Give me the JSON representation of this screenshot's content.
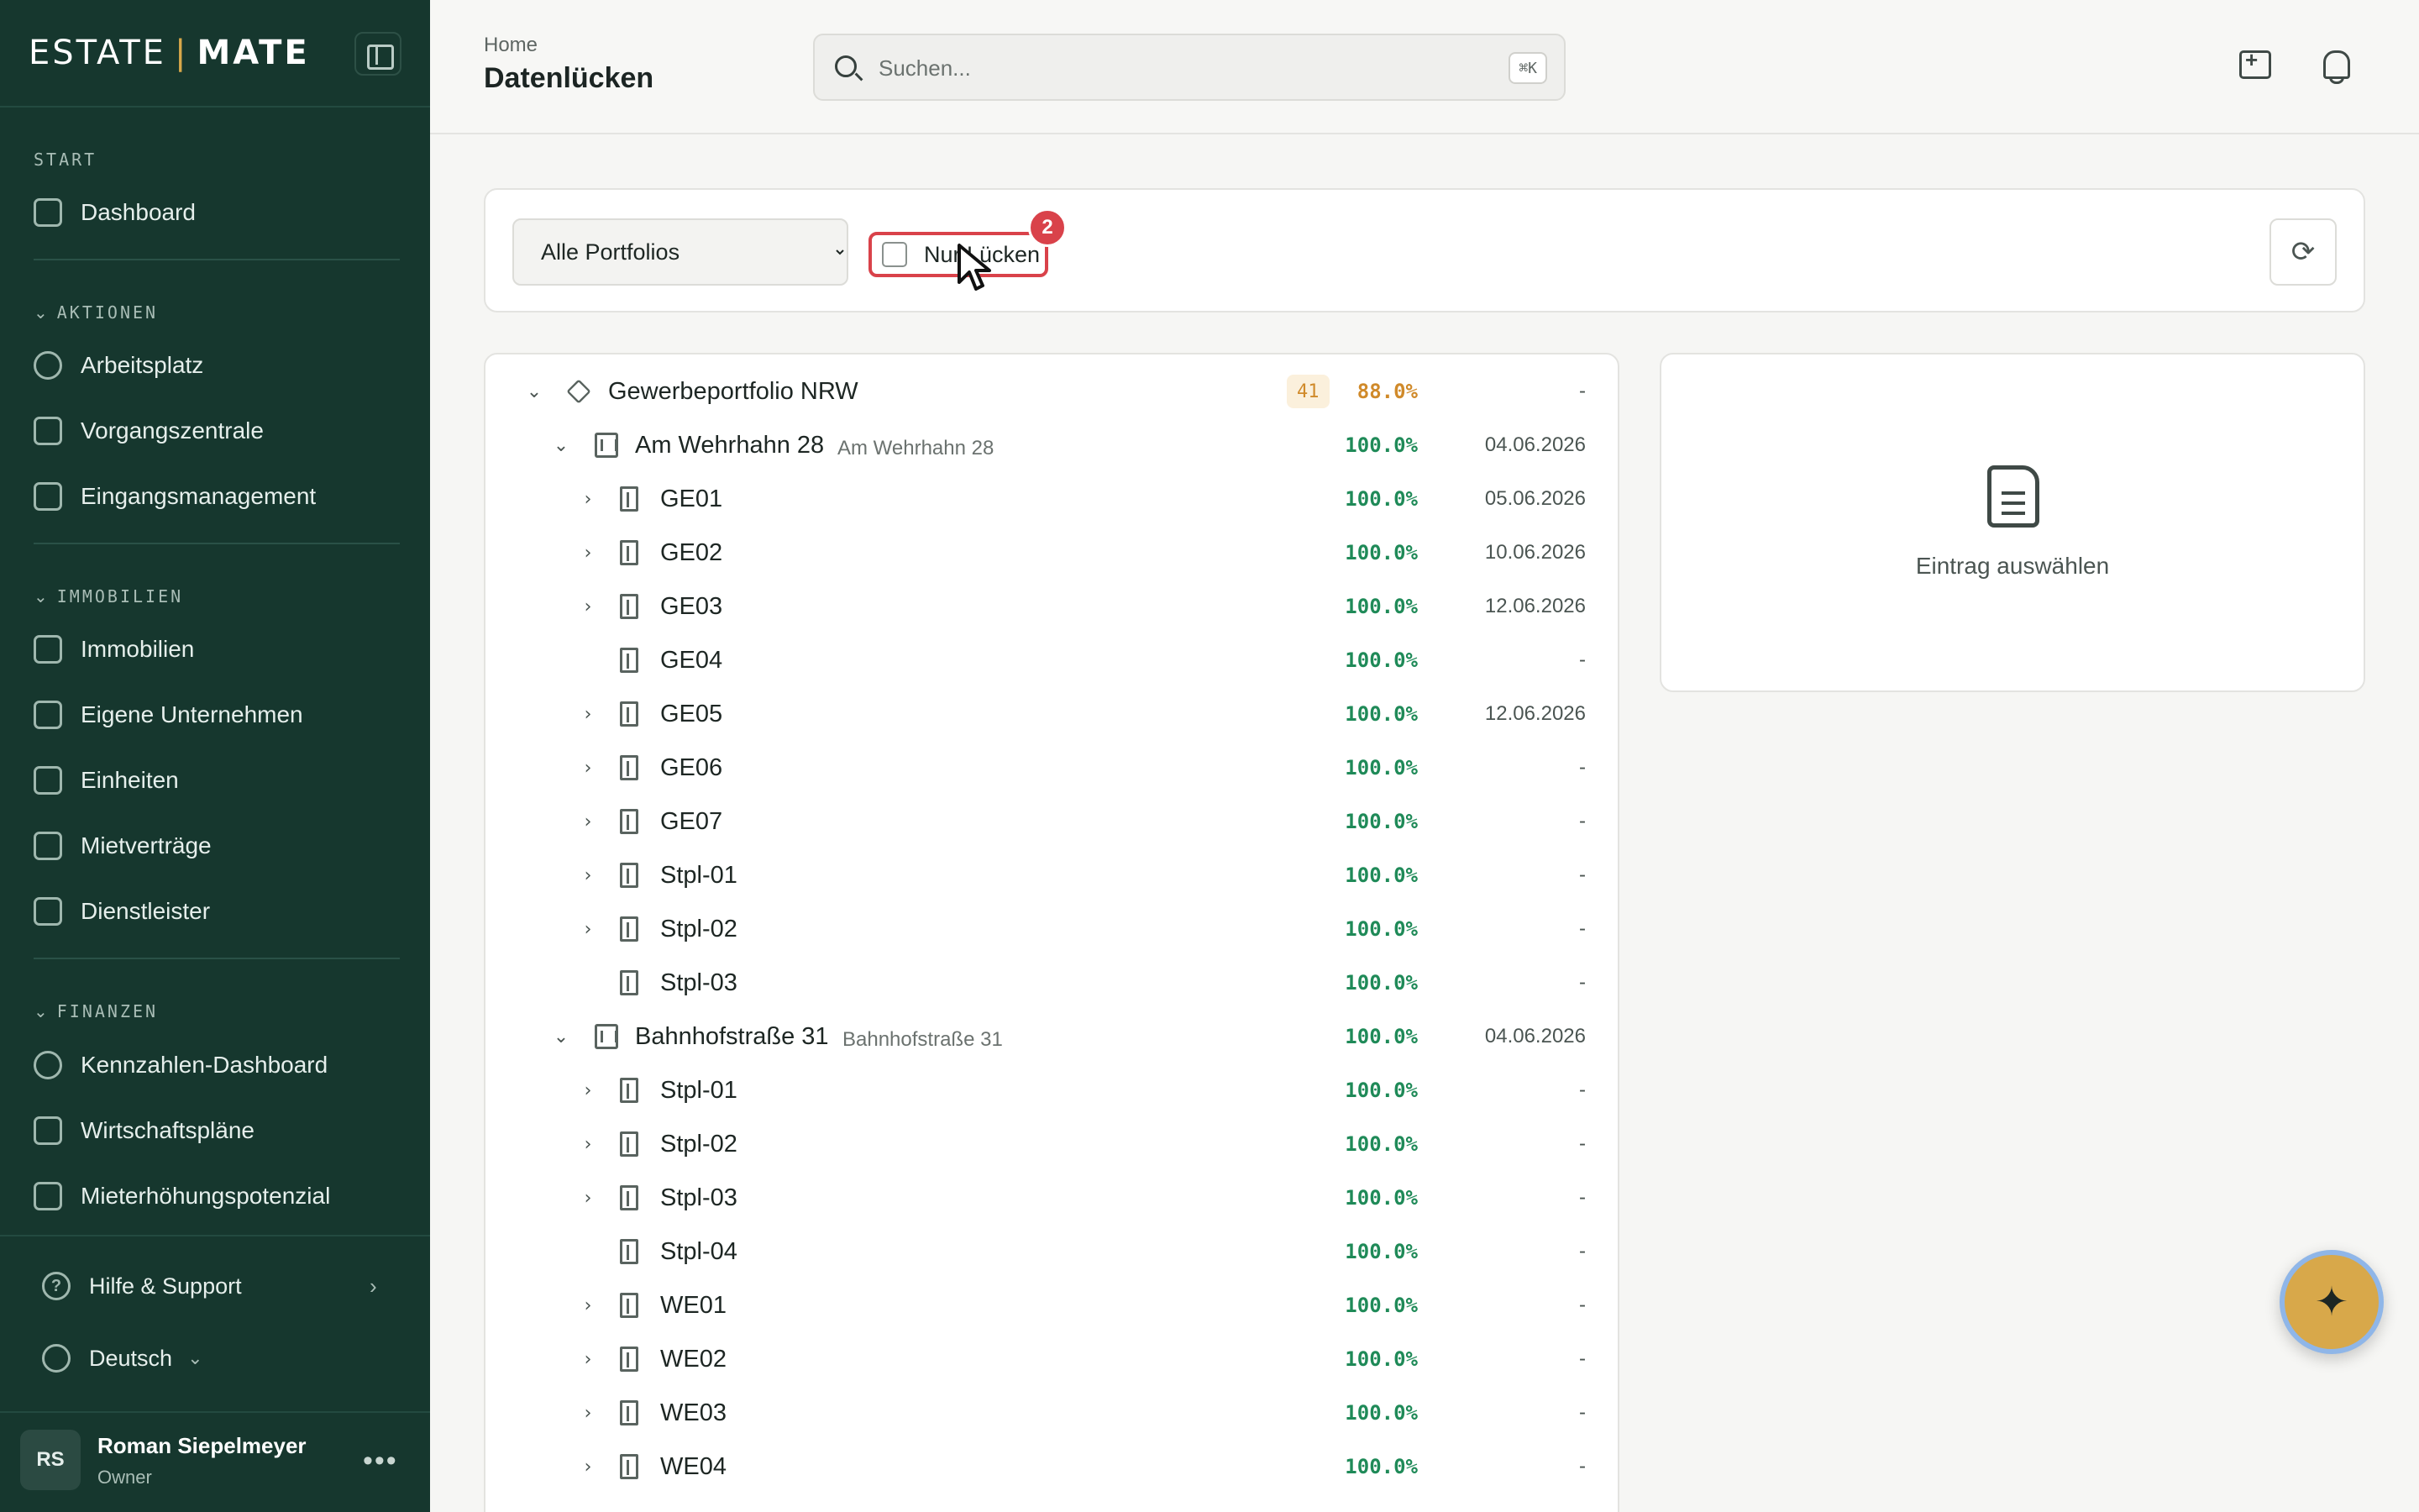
{
  "brand": {
    "part1": "ESTATE",
    "separator": "|",
    "part2": "MATE"
  },
  "sidebar": {
    "sections": [
      {
        "label": "START",
        "items": [
          {
            "label": "Dashboard",
            "icon": "dashboard-icon"
          }
        ]
      },
      {
        "label": "AKTIONEN",
        "items": [
          {
            "label": "Arbeitsplatz",
            "icon": "check-circle-icon"
          },
          {
            "label": "Vorgangszentrale",
            "icon": "workflow-icon"
          },
          {
            "label": "Eingangsmanagement",
            "icon": "inbox-icon"
          }
        ]
      },
      {
        "label": "IMMOBILIEN",
        "items": [
          {
            "label": "Immobilien",
            "icon": "building-icon"
          },
          {
            "label": "Eigene Unternehmen",
            "icon": "factory-icon"
          },
          {
            "label": "Einheiten",
            "icon": "home-icon"
          },
          {
            "label": "Mietverträge",
            "icon": "contract-icon"
          },
          {
            "label": "Dienstleister",
            "icon": "handshake-icon"
          }
        ]
      },
      {
        "label": "FINANZEN",
        "items": [
          {
            "label": "Kennzahlen-Dashboard",
            "icon": "gauge-icon"
          },
          {
            "label": "Wirtschaftspläne",
            "icon": "calculator-icon"
          },
          {
            "label": "Mieterhöhungspotenzial",
            "icon": "bar-chart-icon"
          }
        ]
      }
    ],
    "help": "Hilfe & Support",
    "language": "Deutsch",
    "user": {
      "initials": "RS",
      "name": "Roman Siepelmeyer",
      "role": "Owner"
    }
  },
  "header": {
    "breadcrumb": "Home",
    "title": "Datenlücken",
    "search_placeholder": "Suchen...",
    "search_shortcut": "⌘K"
  },
  "toolbar": {
    "portfolio_options": [
      "Alle Portfolios"
    ],
    "portfolio_selected": "Alle Portfolios",
    "gap_filter_label": "Nur Lücken",
    "gap_filter_checked": false,
    "step_badge": "2"
  },
  "tree": [
    {
      "level": 0,
      "name": "Gewerbeportfolio NRW",
      "count": "41",
      "pct": "88.0%",
      "date": "-",
      "expanded": true,
      "icon": "layers-icon"
    },
    {
      "level": 1,
      "name": "Am Wehrhahn 28",
      "sub": "Am Wehrhahn 28",
      "pct": "100.0%",
      "date": "04.06.2026",
      "expanded": true,
      "icon": "building-icon"
    },
    {
      "level": 2,
      "name": "GE01",
      "pct": "100.0%",
      "date": "05.06.2026",
      "has_children": true,
      "icon": "door-icon"
    },
    {
      "level": 2,
      "name": "GE02",
      "pct": "100.0%",
      "date": "10.06.2026",
      "has_children": true,
      "icon": "door-icon"
    },
    {
      "level": 2,
      "name": "GE03",
      "pct": "100.0%",
      "date": "12.06.2026",
      "has_children": true,
      "icon": "door-icon"
    },
    {
      "level": 2,
      "name": "GE04",
      "pct": "100.0%",
      "date": "-",
      "has_children": false,
      "icon": "door-icon"
    },
    {
      "level": 2,
      "name": "GE05",
      "pct": "100.0%",
      "date": "12.06.2026",
      "has_children": true,
      "icon": "door-icon"
    },
    {
      "level": 2,
      "name": "GE06",
      "pct": "100.0%",
      "date": "-",
      "has_children": true,
      "icon": "door-icon"
    },
    {
      "level": 2,
      "name": "GE07",
      "pct": "100.0%",
      "date": "-",
      "has_children": true,
      "icon": "door-icon"
    },
    {
      "level": 2,
      "name": "Stpl-01",
      "pct": "100.0%",
      "date": "-",
      "has_children": true,
      "icon": "door-icon"
    },
    {
      "level": 2,
      "name": "Stpl-02",
      "pct": "100.0%",
      "date": "-",
      "has_children": true,
      "icon": "door-icon"
    },
    {
      "level": 2,
      "name": "Stpl-03",
      "pct": "100.0%",
      "date": "-",
      "has_children": false,
      "icon": "door-icon"
    },
    {
      "level": 1,
      "name": "Bahnhofstraße 31",
      "sub": "Bahnhofstraße 31",
      "pct": "100.0%",
      "date": "04.06.2026",
      "expanded": true,
      "icon": "building-icon"
    },
    {
      "level": 2,
      "name": "Stpl-01",
      "pct": "100.0%",
      "date": "-",
      "has_children": true,
      "icon": "door-icon"
    },
    {
      "level": 2,
      "name": "Stpl-02",
      "pct": "100.0%",
      "date": "-",
      "has_children": true,
      "icon": "door-icon"
    },
    {
      "level": 2,
      "name": "Stpl-03",
      "pct": "100.0%",
      "date": "-",
      "has_children": true,
      "icon": "door-icon"
    },
    {
      "level": 2,
      "name": "Stpl-04",
      "pct": "100.0%",
      "date": "-",
      "has_children": false,
      "icon": "door-icon"
    },
    {
      "level": 2,
      "name": "WE01",
      "pct": "100.0%",
      "date": "-",
      "has_children": true,
      "icon": "door-icon"
    },
    {
      "level": 2,
      "name": "WE02",
      "pct": "100.0%",
      "date": "-",
      "has_children": true,
      "icon": "door-icon"
    },
    {
      "level": 2,
      "name": "WE03",
      "pct": "100.0%",
      "date": "-",
      "has_children": true,
      "icon": "door-icon"
    },
    {
      "level": 2,
      "name": "WE04",
      "pct": "100.0%",
      "date": "-",
      "has_children": true,
      "icon": "door-icon"
    }
  ],
  "detail": {
    "empty_text": "Eintrag auswählen",
    "icon": "document-icon"
  },
  "fab": {
    "icon": "sparkles-icon"
  },
  "colors": {
    "sidebar_bg": "#16372e",
    "accent_gold": "#d8a84a",
    "success_green": "#1f8a58",
    "warning_orange": "#d08a2a",
    "highlight_red": "#d9424a"
  }
}
